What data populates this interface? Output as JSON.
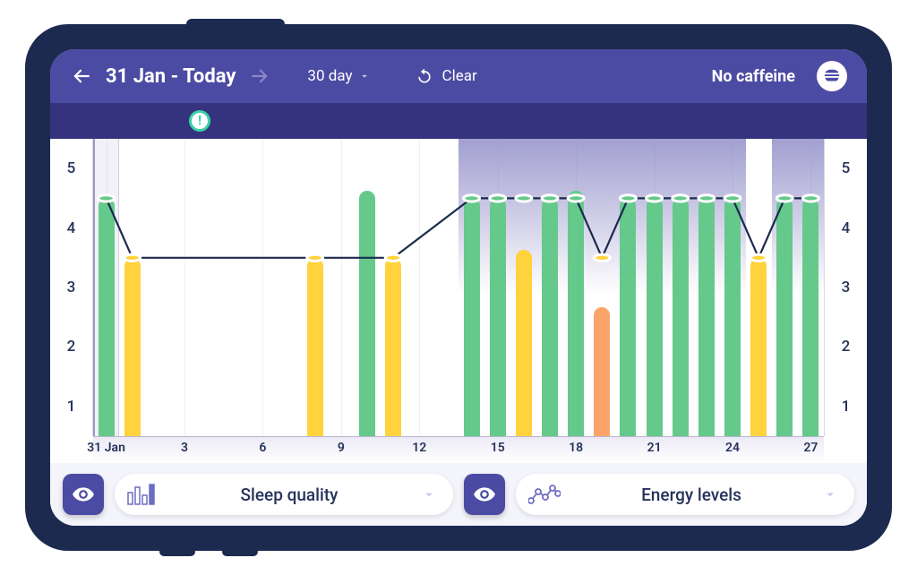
{
  "topbar": {
    "date_range": "31 Jan - Today",
    "range_select": "30 day",
    "clear_label": "Clear",
    "tag_label": "No caffeine"
  },
  "y_ticks_left": [
    "5",
    "4",
    "3",
    "2",
    "1"
  ],
  "y_ticks_right": [
    "5",
    "4",
    "3",
    "2",
    "1"
  ],
  "x_ticks": [
    {
      "label": "31 Jan",
      "pos": 1.79
    },
    {
      "label": "3",
      "pos": 12.5
    },
    {
      "label": "6",
      "pos": 23.21
    },
    {
      "label": "9",
      "pos": 33.93
    },
    {
      "label": "12",
      "pos": 44.64
    },
    {
      "label": "15",
      "pos": 55.36
    },
    {
      "label": "18",
      "pos": 66.07
    },
    {
      "label": "21",
      "pos": 76.79
    },
    {
      "label": "24",
      "pos": 87.5
    },
    {
      "label": "27",
      "pos": 98.21
    }
  ],
  "metrics": {
    "left": "Sleep quality",
    "right": "Energy levels"
  },
  "chart_data": {
    "type": "bar_and_line",
    "title": "",
    "ylabel_left": "Sleep quality",
    "ylabel_right": "Energy levels",
    "ylim": [
      0,
      5
    ],
    "xlabel": "",
    "categories_day_index": [
      1,
      2,
      3,
      4,
      5,
      6,
      7,
      8,
      9,
      10,
      11,
      12,
      13,
      14,
      15,
      16,
      17,
      18,
      19,
      20,
      21,
      22,
      23,
      24,
      25,
      26,
      27,
      28
    ],
    "x_tick_labels": [
      "31 Jan",
      "3",
      "6",
      "9",
      "12",
      "15",
      "18",
      "21",
      "24",
      "27"
    ],
    "series": [
      {
        "name": "Sleep quality",
        "kind": "bar",
        "values": [
          4,
          3,
          null,
          null,
          null,
          null,
          null,
          null,
          3,
          null,
          4.13,
          3,
          null,
          null,
          4,
          4,
          3.13,
          4,
          4.13,
          2.17,
          4,
          4,
          4,
          4,
          4,
          3,
          4,
          4
        ]
      },
      {
        "name": "Energy levels",
        "kind": "line",
        "values": [
          4,
          3,
          null,
          null,
          null,
          null,
          null,
          null,
          3,
          null,
          null,
          3,
          null,
          null,
          4,
          4,
          4,
          4,
          4,
          3,
          4,
          4,
          4,
          4,
          4,
          3,
          4,
          4
        ]
      }
    ],
    "bar_colors_by_value": {
      "4": "green",
      "4.13": "green",
      "3": "yellow",
      "3.13": "yellow",
      "2.17": "orange"
    },
    "highlight_tag": "No caffeine",
    "highlight_days": [
      15,
      16,
      17,
      18,
      19,
      20,
      21,
      22,
      23,
      24,
      25
    ],
    "highlight_days_2": [
      27,
      28
    ]
  }
}
